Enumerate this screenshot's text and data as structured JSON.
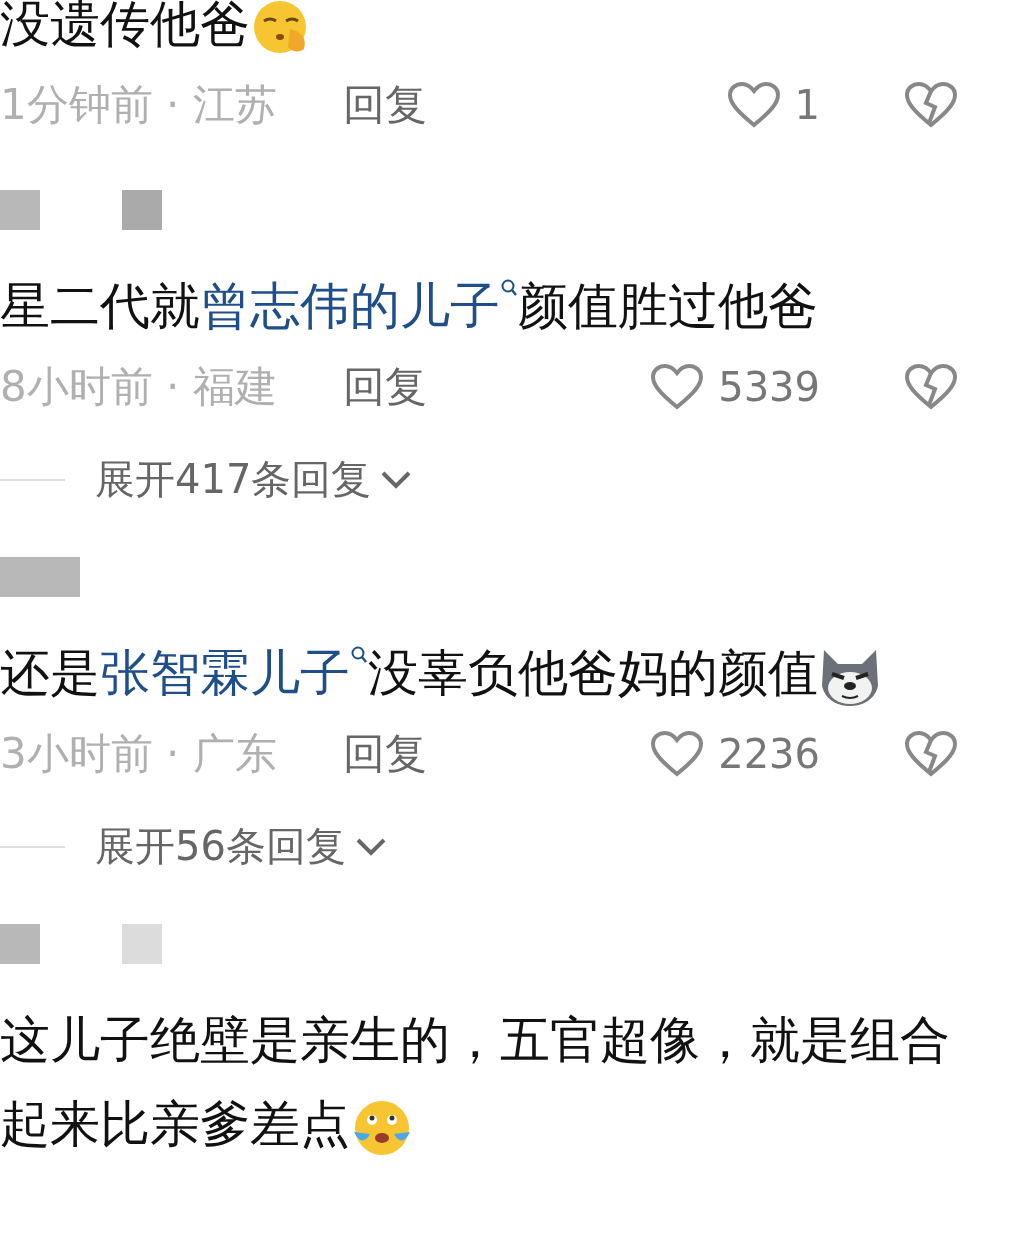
{
  "comments": [
    {
      "redacted": false,
      "segments": [
        {
          "kind": "text",
          "text": "没遗传他爸"
        },
        {
          "kind": "emoji"
        }
      ],
      "time": "1分钟前 · 江苏",
      "reply": "回复",
      "likes": "1"
    },
    {
      "redacted": true,
      "segments": [
        {
          "kind": "text",
          "text": "星二代就"
        },
        {
          "kind": "link",
          "text": "曾志伟的儿子"
        },
        {
          "kind": "text",
          "text": "颜值胜过他爸"
        }
      ],
      "time": "8小时前 · 福建",
      "reply": "回复",
      "likes": "5339",
      "expand": "展开417条回复"
    },
    {
      "redacted": true,
      "segments": [
        {
          "kind": "text",
          "text": "还是"
        },
        {
          "kind": "link",
          "text": "张智霖儿子"
        },
        {
          "kind": "text",
          "text": "没辜负他爸妈的颜值"
        },
        {
          "kind": "emoji"
        }
      ],
      "time": "3小时前 · 广东",
      "reply": "回复",
      "likes": "2236",
      "expand": "展开56条回复"
    },
    {
      "redacted": true,
      "segments": [
        {
          "kind": "text",
          "text": "这儿子绝壁是亲生的，五官超像，就是组合起来比亲爹差点"
        },
        {
          "kind": "emoji"
        }
      ]
    }
  ]
}
